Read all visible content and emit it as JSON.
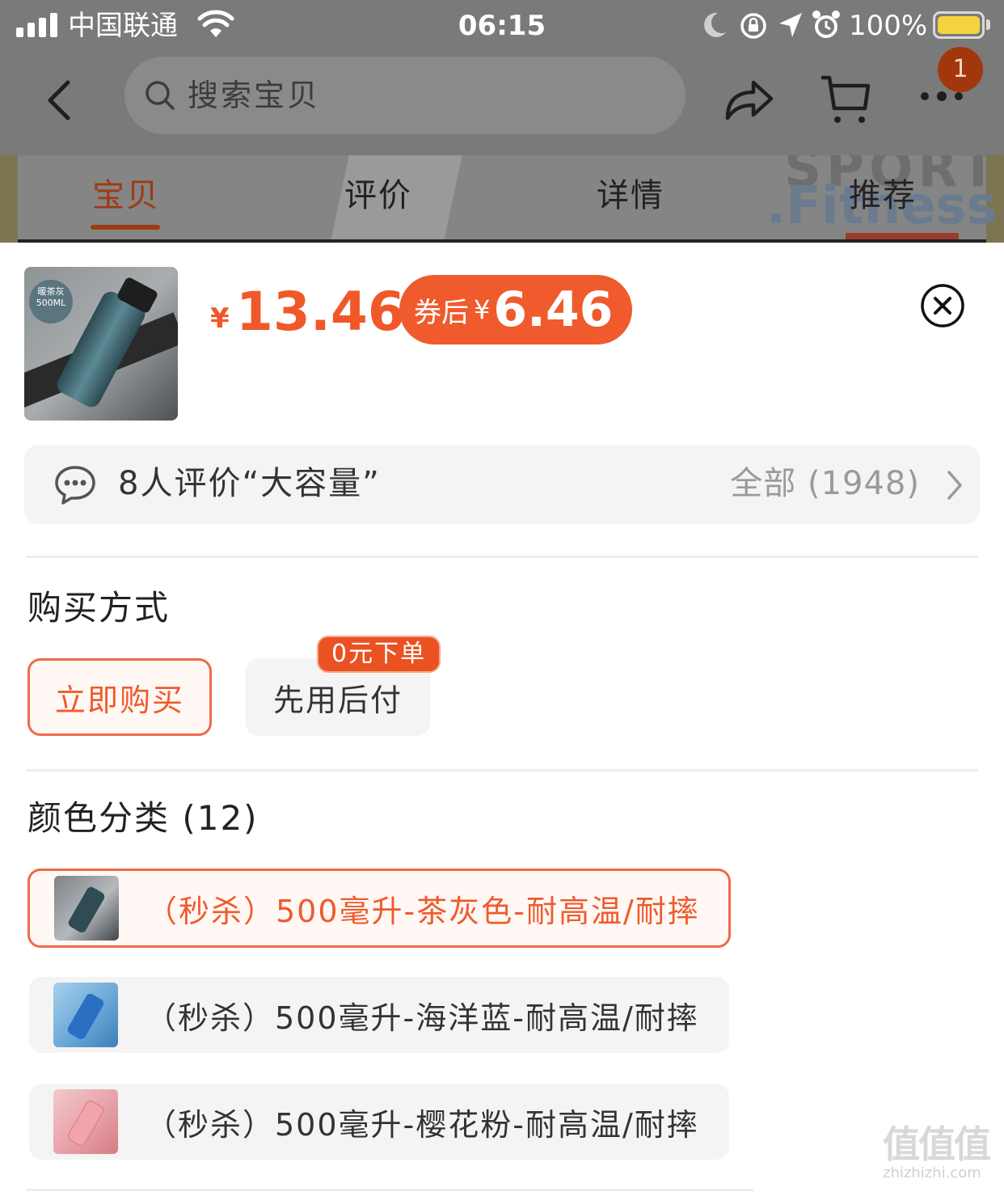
{
  "status_bar": {
    "carrier": "中国联通",
    "time": "06:15",
    "battery": "100%"
  },
  "nav": {
    "search_placeholder": "搜索宝贝",
    "cart_badge": "1"
  },
  "tabs": [
    {
      "label": "宝贝",
      "active": true
    },
    {
      "label": "评价",
      "active": false
    },
    {
      "label": "详情",
      "active": false
    },
    {
      "label": "推荐",
      "active": false
    }
  ],
  "product": {
    "currency": "¥",
    "price": "13.46",
    "coupon_label": "券后",
    "coupon_currency": "¥",
    "coupon_price": "6.46",
    "thumb_tag_line1": "暖茶灰",
    "thumb_tag_line2": "500ML"
  },
  "review": {
    "summary": "8人评价“大容量”",
    "all": "全部 (1948)"
  },
  "purchase": {
    "title": "购买方式",
    "options": [
      {
        "label": "立即购买",
        "selected": true
      },
      {
        "label": "先用后付",
        "selected": false
      }
    ],
    "badge": "0元下单"
  },
  "colors": {
    "title": "颜色分类 (12)",
    "variants": [
      {
        "label": "（秒杀）500毫升-茶灰色-耐高温/耐摔",
        "selected": true
      },
      {
        "label": "（秒杀）500毫升-海洋蓝-耐高温/耐摔",
        "selected": false
      },
      {
        "label": "（秒杀）500毫升-樱花粉-耐高温/耐摔",
        "selected": false
      }
    ]
  },
  "watermark": {
    "big": "值值值",
    "small": "zhizhizhi.com"
  },
  "theme": {
    "accent": "#EF5B2C",
    "overlay_gray": "#7A7A7A",
    "chip_bg": "#F4F4F4"
  }
}
